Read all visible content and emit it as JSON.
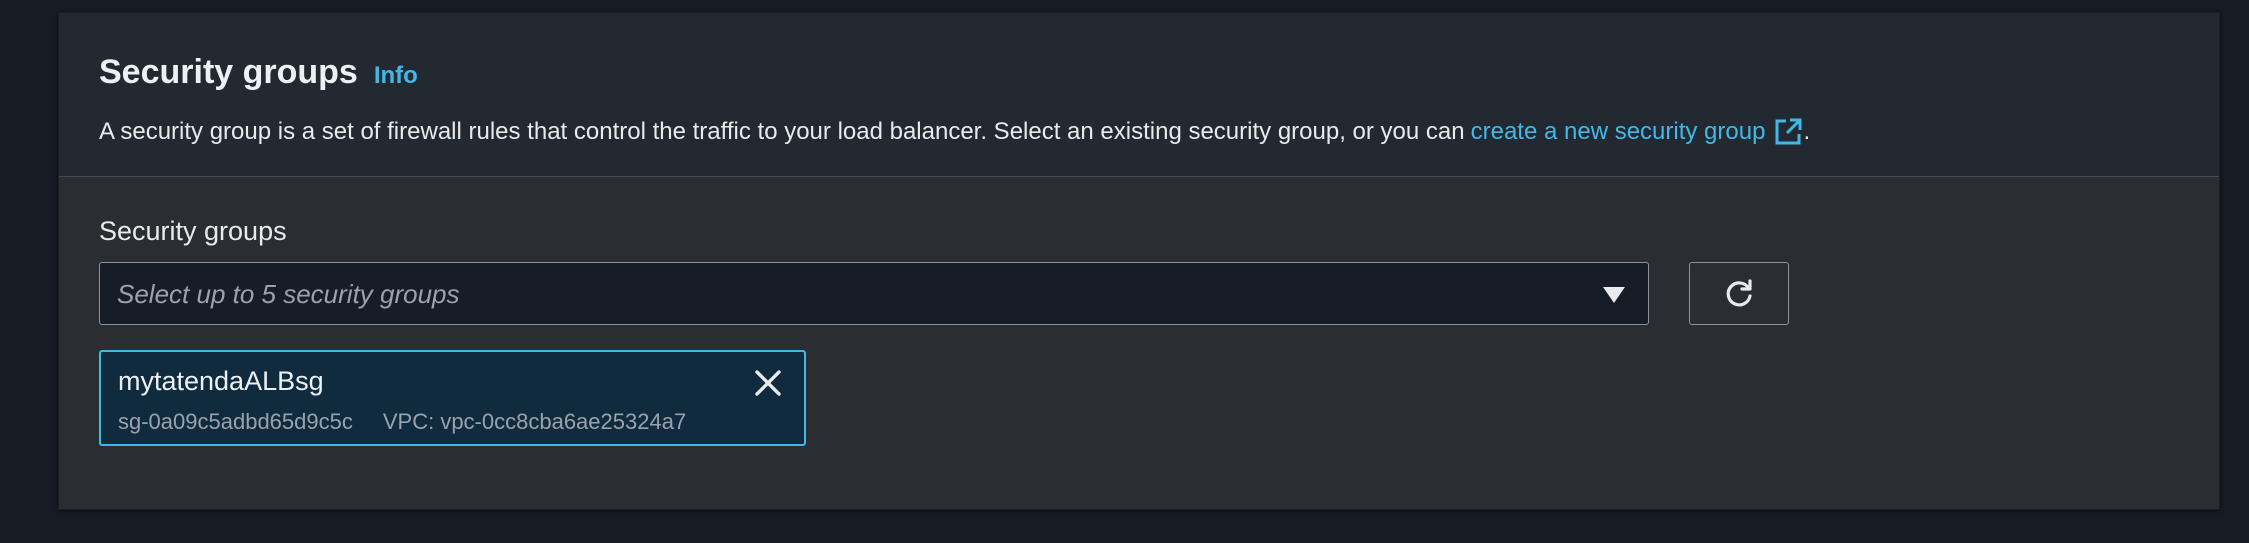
{
  "section": {
    "title": "Security groups",
    "info_link": "Info",
    "description_prefix": "A security group is a set of firewall rules that control the traffic to your load balancer. Select an existing security group, or you can",
    "create_link": "create a new security group",
    "description_suffix": "."
  },
  "field": {
    "label": "Security groups",
    "placeholder": "Select up to 5 security groups"
  },
  "icons": {
    "external_link": "external-link-icon",
    "dropdown": "caret-down-icon",
    "refresh": "refresh-icon",
    "remove": "close-icon"
  },
  "selected_groups": [
    {
      "name": "mytatendaALBsg",
      "id": "sg-0a09c5adbd65d9c5c",
      "vpc": "VPC: vpc-0cc8cba6ae25324a7"
    }
  ],
  "colors": {
    "link": "#42b8e8",
    "token_border": "#42b8e8",
    "token_background": "#0f2b3d",
    "panel": "#2a2e33",
    "header": "#222930"
  }
}
